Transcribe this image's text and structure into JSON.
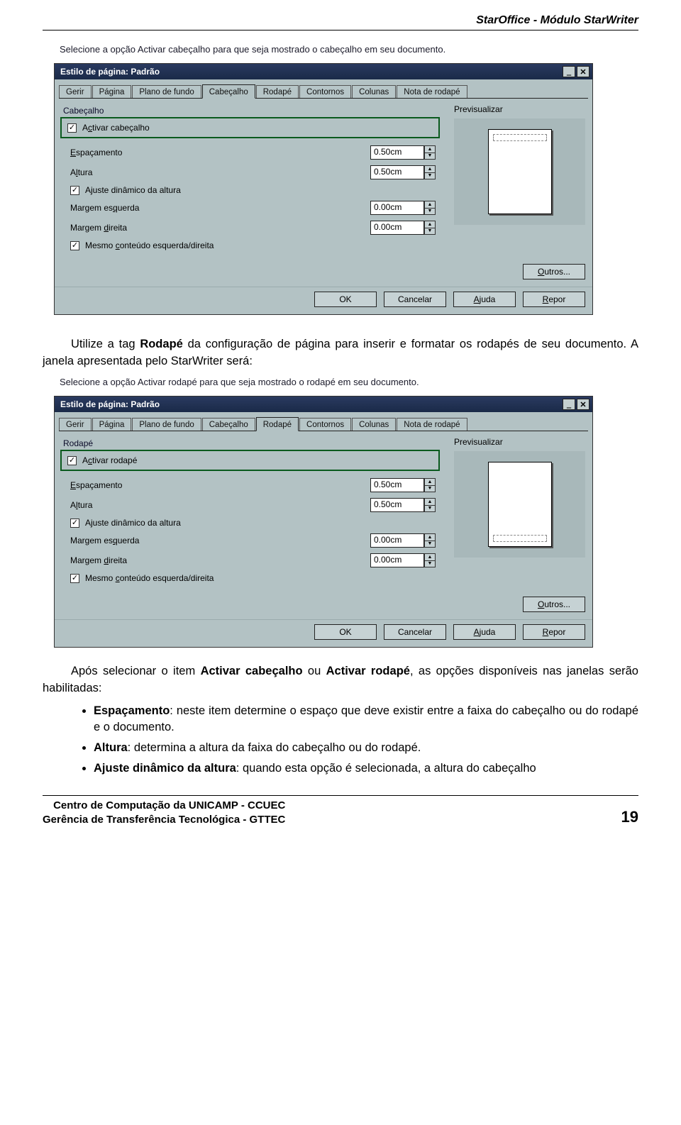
{
  "header_title": "StarOffice - Módulo StarWriter",
  "tip1": "Selecione a opção Activar cabeçalho para que seja mostrado o cabeçalho em seu documento.",
  "tip2": "Selecione a opção Activar rodapé para que seja mostrado o rodapé em seu documento.",
  "dialog1": {
    "title": "Estilo de página: Padrão",
    "tabs": [
      "Gerir",
      "Página",
      "Plano de fundo",
      "Cabeçalho",
      "Rodapé",
      "Contornos",
      "Colunas",
      "Nota de rodapé"
    ],
    "active_tab": 3,
    "group_label": "Cabeçalho",
    "preview_label": "Previsualizar",
    "activate_label": "Activar cabeçalho",
    "spacing_label": "Espaçamento",
    "spacing_value": "0.50cm",
    "height_label": "Altura",
    "height_value": "0.50cm",
    "dynamic_label": "Ajuste dinâmico da altura",
    "margin_left_label": "Margem esquerda",
    "margin_left_value": "0.00cm",
    "margin_right_label": "Margem direita",
    "margin_right_value": "0.00cm",
    "same_content_label": "Mesmo conteúdo esquerda/direita",
    "others_btn": "Outros...",
    "ok": "OK",
    "cancel": "Cancelar",
    "help": "Ajuda",
    "reset": "Repor"
  },
  "dialog2": {
    "title": "Estilo de página: Padrão",
    "tabs": [
      "Gerir",
      "Página",
      "Plano de fundo",
      "Cabeçalho",
      "Rodapé",
      "Contornos",
      "Colunas",
      "Nota de rodapé"
    ],
    "active_tab": 4,
    "group_label": "Rodapé",
    "preview_label": "Previsualizar",
    "activate_label": "Activar rodapé",
    "spacing_label": "Espaçamento",
    "spacing_value": "0.50cm",
    "height_label": "Altura",
    "height_value": "0.50cm",
    "dynamic_label": "Ajuste dinâmico da altura",
    "margin_left_label": "Margem esquerda",
    "margin_left_value": "0.00cm",
    "margin_right_label": "Margem direita",
    "margin_right_value": "0.00cm",
    "same_content_label": "Mesmo conteúdo esquerda/direita",
    "others_btn": "Outros...",
    "ok": "OK",
    "cancel": "Cancelar",
    "help": "Ajuda",
    "reset": "Repor"
  },
  "article": {
    "p1_a": "Utilize a tag ",
    "p1_b": "Rodapé",
    "p1_c": " da configuração de página para inserir e formatar os rodapés de seu documento.",
    "p1_d": " A janela apresentada pelo StarWriter será:",
    "p2_a": "Após selecionar o item ",
    "p2_b": "Activar cabeçalho",
    "p2_c": " ou ",
    "p2_d": "Activar rodapé",
    "p2_e": ", as opções disponíveis nas janelas serão habilitadas:",
    "bullets": [
      {
        "term": "Espaçamento",
        "text": ": neste item determine o espaço que deve existir entre a faixa do cabeçalho ou do rodapé e o documento."
      },
      {
        "term": "Altura",
        "text": ": determina a altura da faixa do cabeçalho ou do rodapé."
      },
      {
        "term": "Ajuste dinâmico da altura",
        "text": ": quando esta opção é selecionada, a altura do cabeçalho"
      }
    ]
  },
  "footer": {
    "line1": "Centro de Computação da UNICAMP - CCUEC",
    "line2": "Gerência de Transferência Tecnológica - GTTEC",
    "page": "19"
  }
}
